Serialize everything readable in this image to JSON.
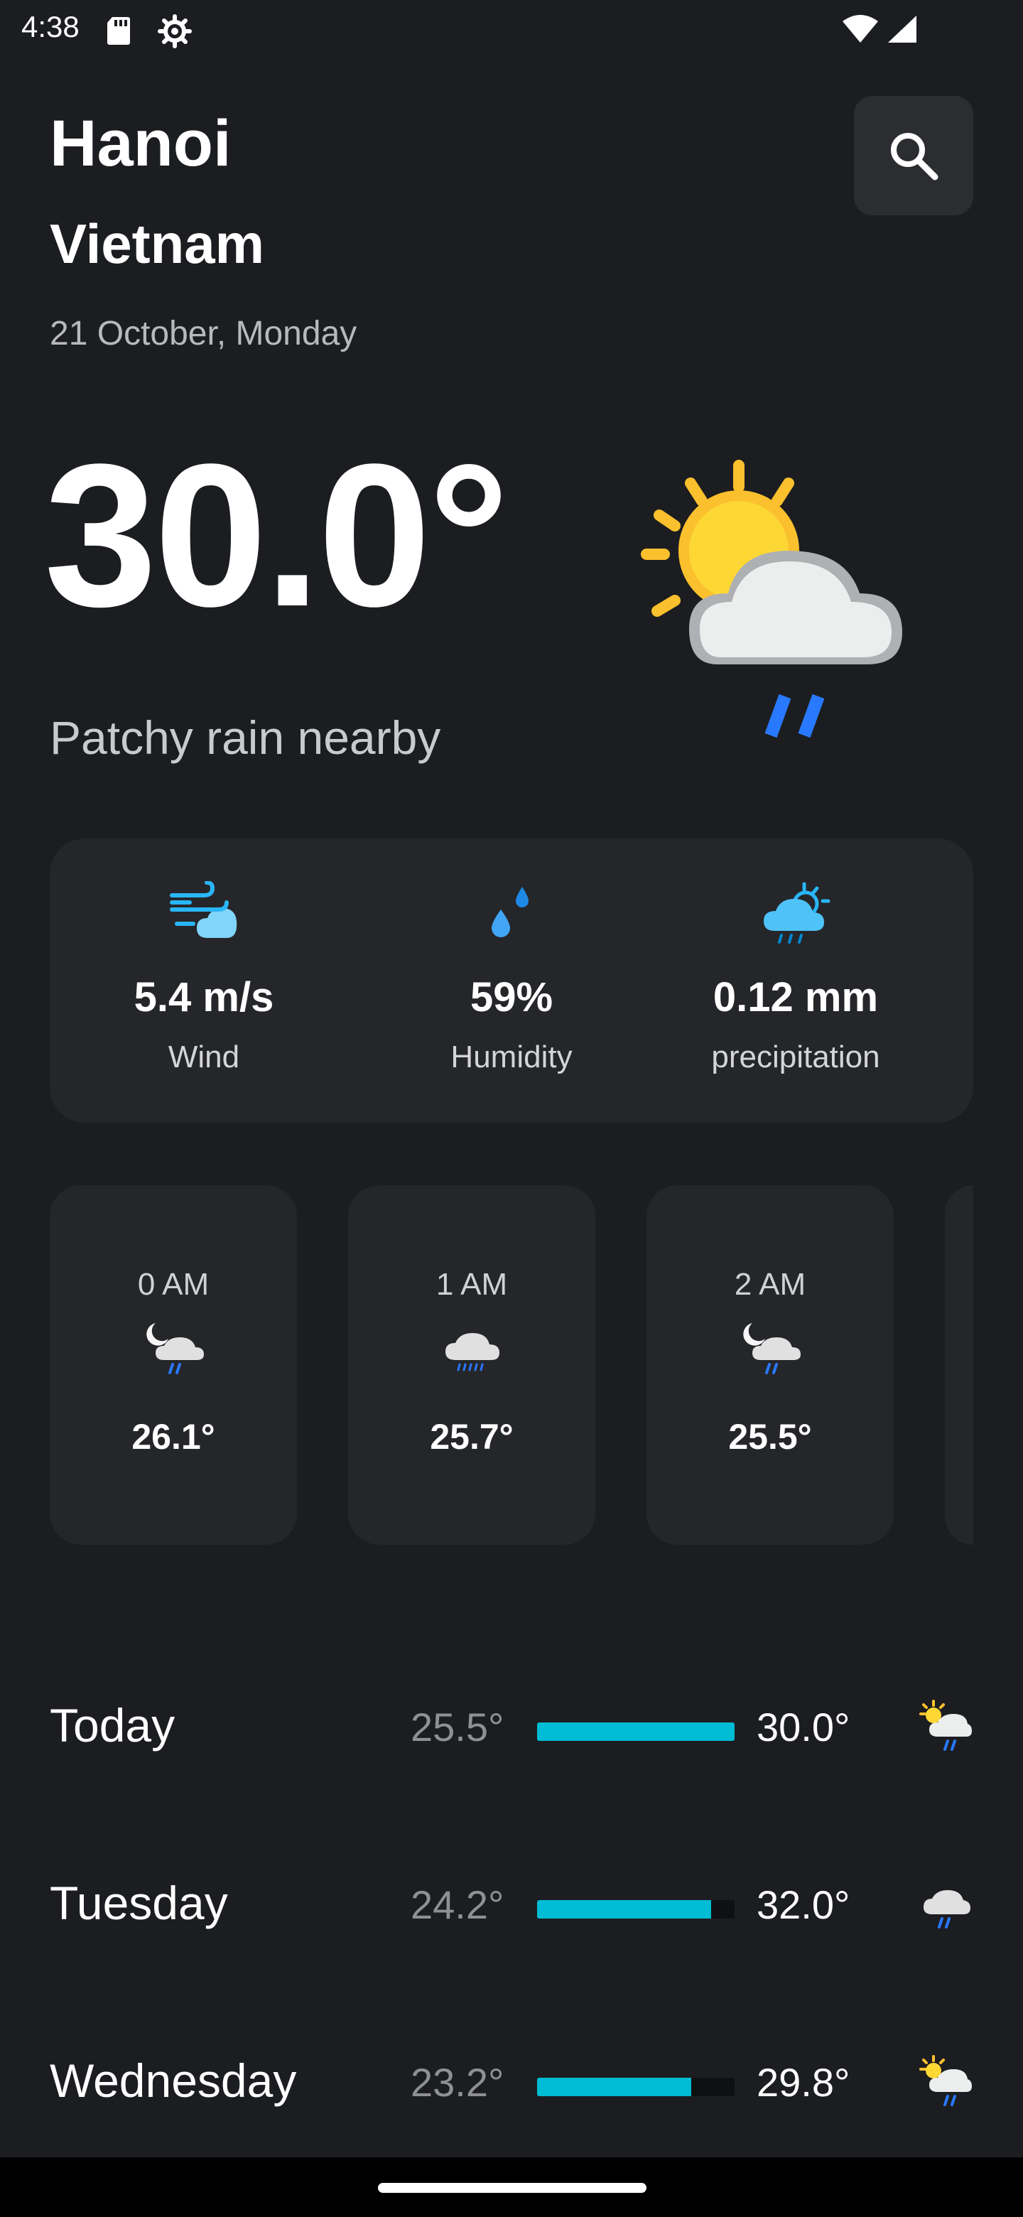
{
  "status_bar": {
    "time": "4:38",
    "icons": [
      "sd-card-icon",
      "gear-icon",
      "wifi-icon",
      "signal-icon"
    ]
  },
  "location": {
    "city": "Hanoi",
    "country": "Vietnam",
    "date": "21 October, Monday"
  },
  "search": {
    "icon": "search-icon"
  },
  "current": {
    "temperature": "30.0°",
    "condition": "Patchy rain nearby",
    "icon": "sun-cloud-rain-icon"
  },
  "stats": [
    {
      "value": "5.4 m/s",
      "label": "Wind",
      "icon": "wind-icon"
    },
    {
      "value": "59%",
      "label": "Humidity",
      "icon": "humidity-icon"
    },
    {
      "value": "0.12 mm",
      "label": "precipitation",
      "icon": "precipitation-icon"
    }
  ],
  "hourly": [
    {
      "time": "0 AM",
      "temp": "26.1°",
      "icon": "moon-cloud-rain-icon"
    },
    {
      "time": "1 AM",
      "temp": "25.7°",
      "icon": "cloud-rain-icon"
    },
    {
      "time": "2 AM",
      "temp": "25.5°",
      "icon": "moon-cloud-rain-icon"
    }
  ],
  "daily": [
    {
      "day": "Today",
      "min": "25.5°",
      "max": "30.0°",
      "range_fill": 1.0,
      "icon": "sun-cloud-rain-icon"
    },
    {
      "day": "Tuesday",
      "min": "24.2°",
      "max": "32.0°",
      "range_fill": 0.88,
      "icon": "cloud-rain-icon"
    },
    {
      "day": "Wednesday",
      "min": "23.2°",
      "max": "29.8°",
      "range_fill": 0.78,
      "icon": "sun-cloud-rain-icon"
    }
  ],
  "colors": {
    "background": "#1c1d20",
    "card": "#25262a",
    "accent": "#00bcd4",
    "sun": "#fbc02d",
    "rain": "#2979ff"
  }
}
